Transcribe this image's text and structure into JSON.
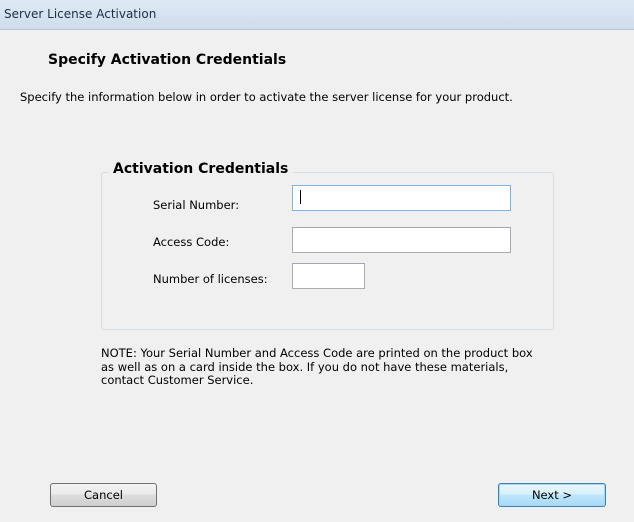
{
  "window": {
    "title": "Server License Activation"
  },
  "page": {
    "title": "Specify Activation Credentials",
    "description": "Specify the information below in order to activate the server license for your product."
  },
  "credentials": {
    "group_title": "Activation Credentials",
    "serial_number": {
      "label": "Serial Number:",
      "value": ""
    },
    "access_code": {
      "label": "Access Code:",
      "value": ""
    },
    "number_of_licenses": {
      "label": "Number of licenses:",
      "value": ""
    }
  },
  "note": {
    "lines": [
      "NOTE:  Your Serial Number and Access Code are printed on the product box",
      "as well as on a card inside the box.  If you do not have these materials,",
      "contact Customer Service."
    ]
  },
  "buttons": {
    "cancel_label": "Cancel",
    "next_label": "Next >"
  }
}
